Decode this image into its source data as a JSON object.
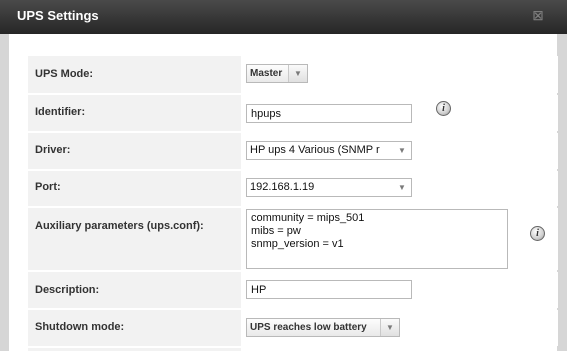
{
  "dialog": {
    "title": "UPS Settings",
    "close_label": "☒"
  },
  "fields": {
    "ups_mode": {
      "label": "UPS Mode:",
      "value": "Master"
    },
    "identifier": {
      "label": "Identifier:",
      "value": "hpups",
      "info": "i"
    },
    "driver": {
      "label": "Driver:",
      "value": "HP ups 4 Various (SNMP r"
    },
    "port": {
      "label": "Port:",
      "value": "192.168.1.19"
    },
    "aux_params": {
      "label": "Auxiliary parameters (ups.conf):",
      "value": "community = mips_501\nmibs = pw\nsnmp_version = v1",
      "info": "i"
    },
    "description": {
      "label": "Description:",
      "value": "HP"
    },
    "shutdown_mode": {
      "label": "Shutdown mode:",
      "value": "UPS reaches low battery"
    }
  },
  "icons": {
    "caret": "▼"
  }
}
